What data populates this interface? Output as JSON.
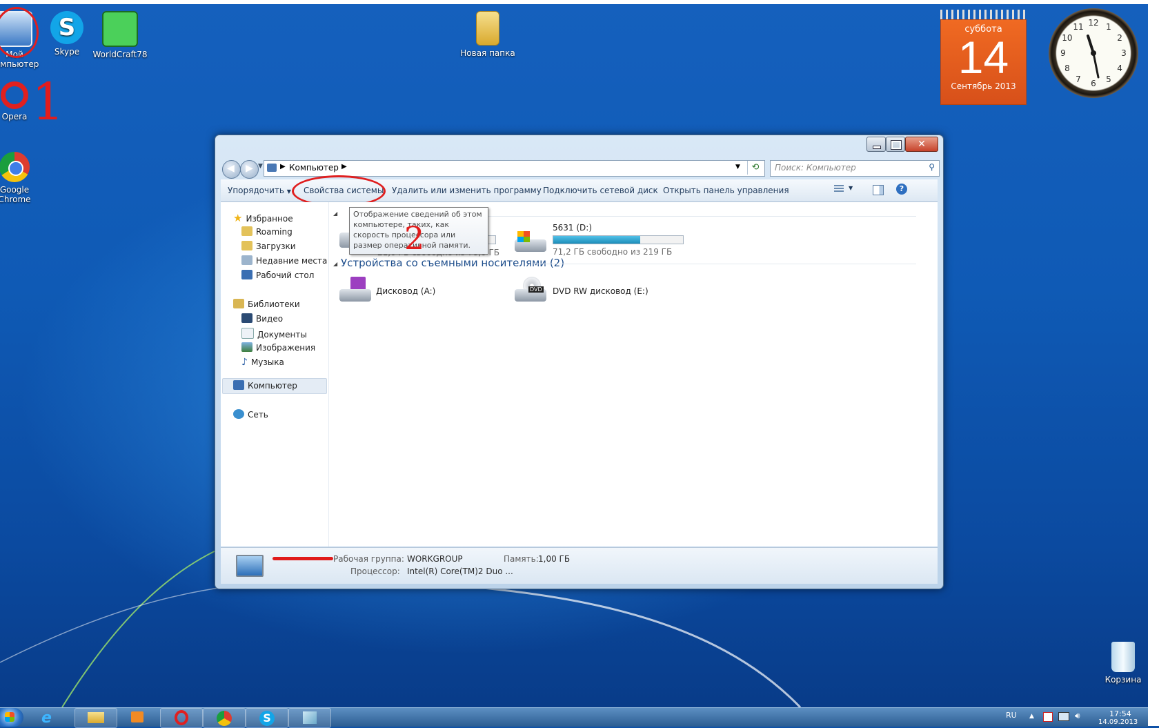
{
  "desktop": {
    "icons": [
      {
        "label": "Мой компьютер",
        "icon": "computer-icon"
      },
      {
        "label": "Skype",
        "icon": "skype-icon"
      },
      {
        "label": "WorldCraft78",
        "icon": "worldcraft-icon"
      },
      {
        "label": "Новая папка",
        "icon": "folder-icon"
      },
      {
        "label": "Opera",
        "icon": "opera-icon"
      },
      {
        "label": "Google Chrome",
        "icon": "chrome-icon"
      },
      {
        "label": "Корзина",
        "icon": "recycle-bin-icon"
      }
    ],
    "annotations": {
      "step1": "1",
      "step2": "2"
    },
    "calendar": {
      "weekday": "суббота",
      "day": "14",
      "month_year": "Сентябрь 2013"
    },
    "clock": {
      "numerals": [
        "12",
        "1",
        "2",
        "3",
        "4",
        "5",
        "6",
        "7",
        "8",
        "9",
        "10",
        "11"
      ]
    }
  },
  "window": {
    "breadcrumb": {
      "root": "Компьютер"
    },
    "search_placeholder": "Поиск: Компьютер",
    "toolbar": {
      "organize": "Упорядочить",
      "system_properties": "Свойства системы",
      "uninstall": "Удалить или изменить программу",
      "map_drive": "Подключить сетевой диск",
      "control_panel": "Открыть панель управления"
    },
    "tooltip": "Отображение сведений об этом компьютере, таких, как скорость процессора или размер оперативной памяти.",
    "nav": {
      "favorites": "Избранное",
      "fav_items": [
        "Roaming",
        "Загрузки",
        "Недавние места",
        "Рабочий стол"
      ],
      "libraries": "Библиотеки",
      "lib_items": [
        "Видео",
        "Документы",
        "Изображения",
        "Музыка"
      ],
      "computer": "Компьютер",
      "network": "Сеть"
    },
    "drives": {
      "c": {
        "free": "21,0 ГБ свободно из 78,0 ГБ",
        "used_fraction": 0.73
      },
      "d": {
        "name": "5631 (D:)",
        "free": "71,2 ГБ свободно из 219 ГБ",
        "used_fraction": 0.67
      }
    },
    "removable": {
      "title": "Устройства со съемными носителями (2)",
      "floppy": "Дисковод (A:)",
      "dvd": "DVD RW дисковод (E:)",
      "dvd_badge": "DVD"
    },
    "status": {
      "workgroup_label": "Рабочая группа:",
      "workgroup_value": "WORKGROUP",
      "memory_label": "Память:",
      "memory_value": "1,00 ГБ",
      "cpu_label": "Процессор:",
      "cpu_value": "Intel(R) Core(TM)2 Duo ..."
    }
  },
  "taskbar": {
    "language": "RU",
    "time": "17:54",
    "date": "14.09.2013"
  }
}
